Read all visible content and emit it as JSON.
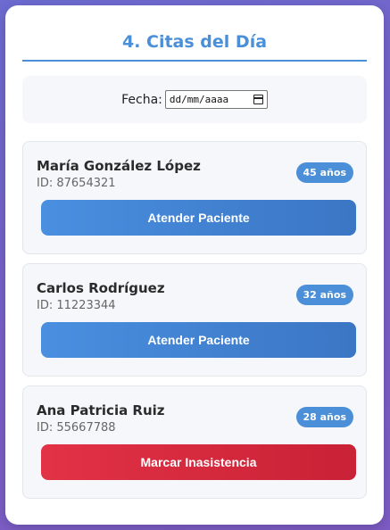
{
  "page": {
    "title": "4. Citas del Día"
  },
  "date_filter": {
    "label": "Fecha:",
    "placeholder": "dd/mm/aaaa",
    "icon": "calendar-icon"
  },
  "patients": [
    {
      "name": "María González López",
      "id": "ID: 87654321",
      "age": "45 años",
      "action": "Atender Paciente",
      "action_color": "#4a8fe0"
    },
    {
      "name": "Carlos Rodríguez",
      "id": "ID: 11223344",
      "age": "32 años",
      "action": "Atender Paciente",
      "action_color": "#4a8fe0"
    },
    {
      "name": "Ana Patricia Ruiz",
      "id": "ID: 55667788",
      "age": "28 años",
      "action": "Marcar Inasistencia",
      "action_color": "#e23246"
    }
  ],
  "colors": {
    "accent": "#4a8fd8",
    "danger": "#dc3545",
    "card_bg": "#f5f7fa"
  }
}
